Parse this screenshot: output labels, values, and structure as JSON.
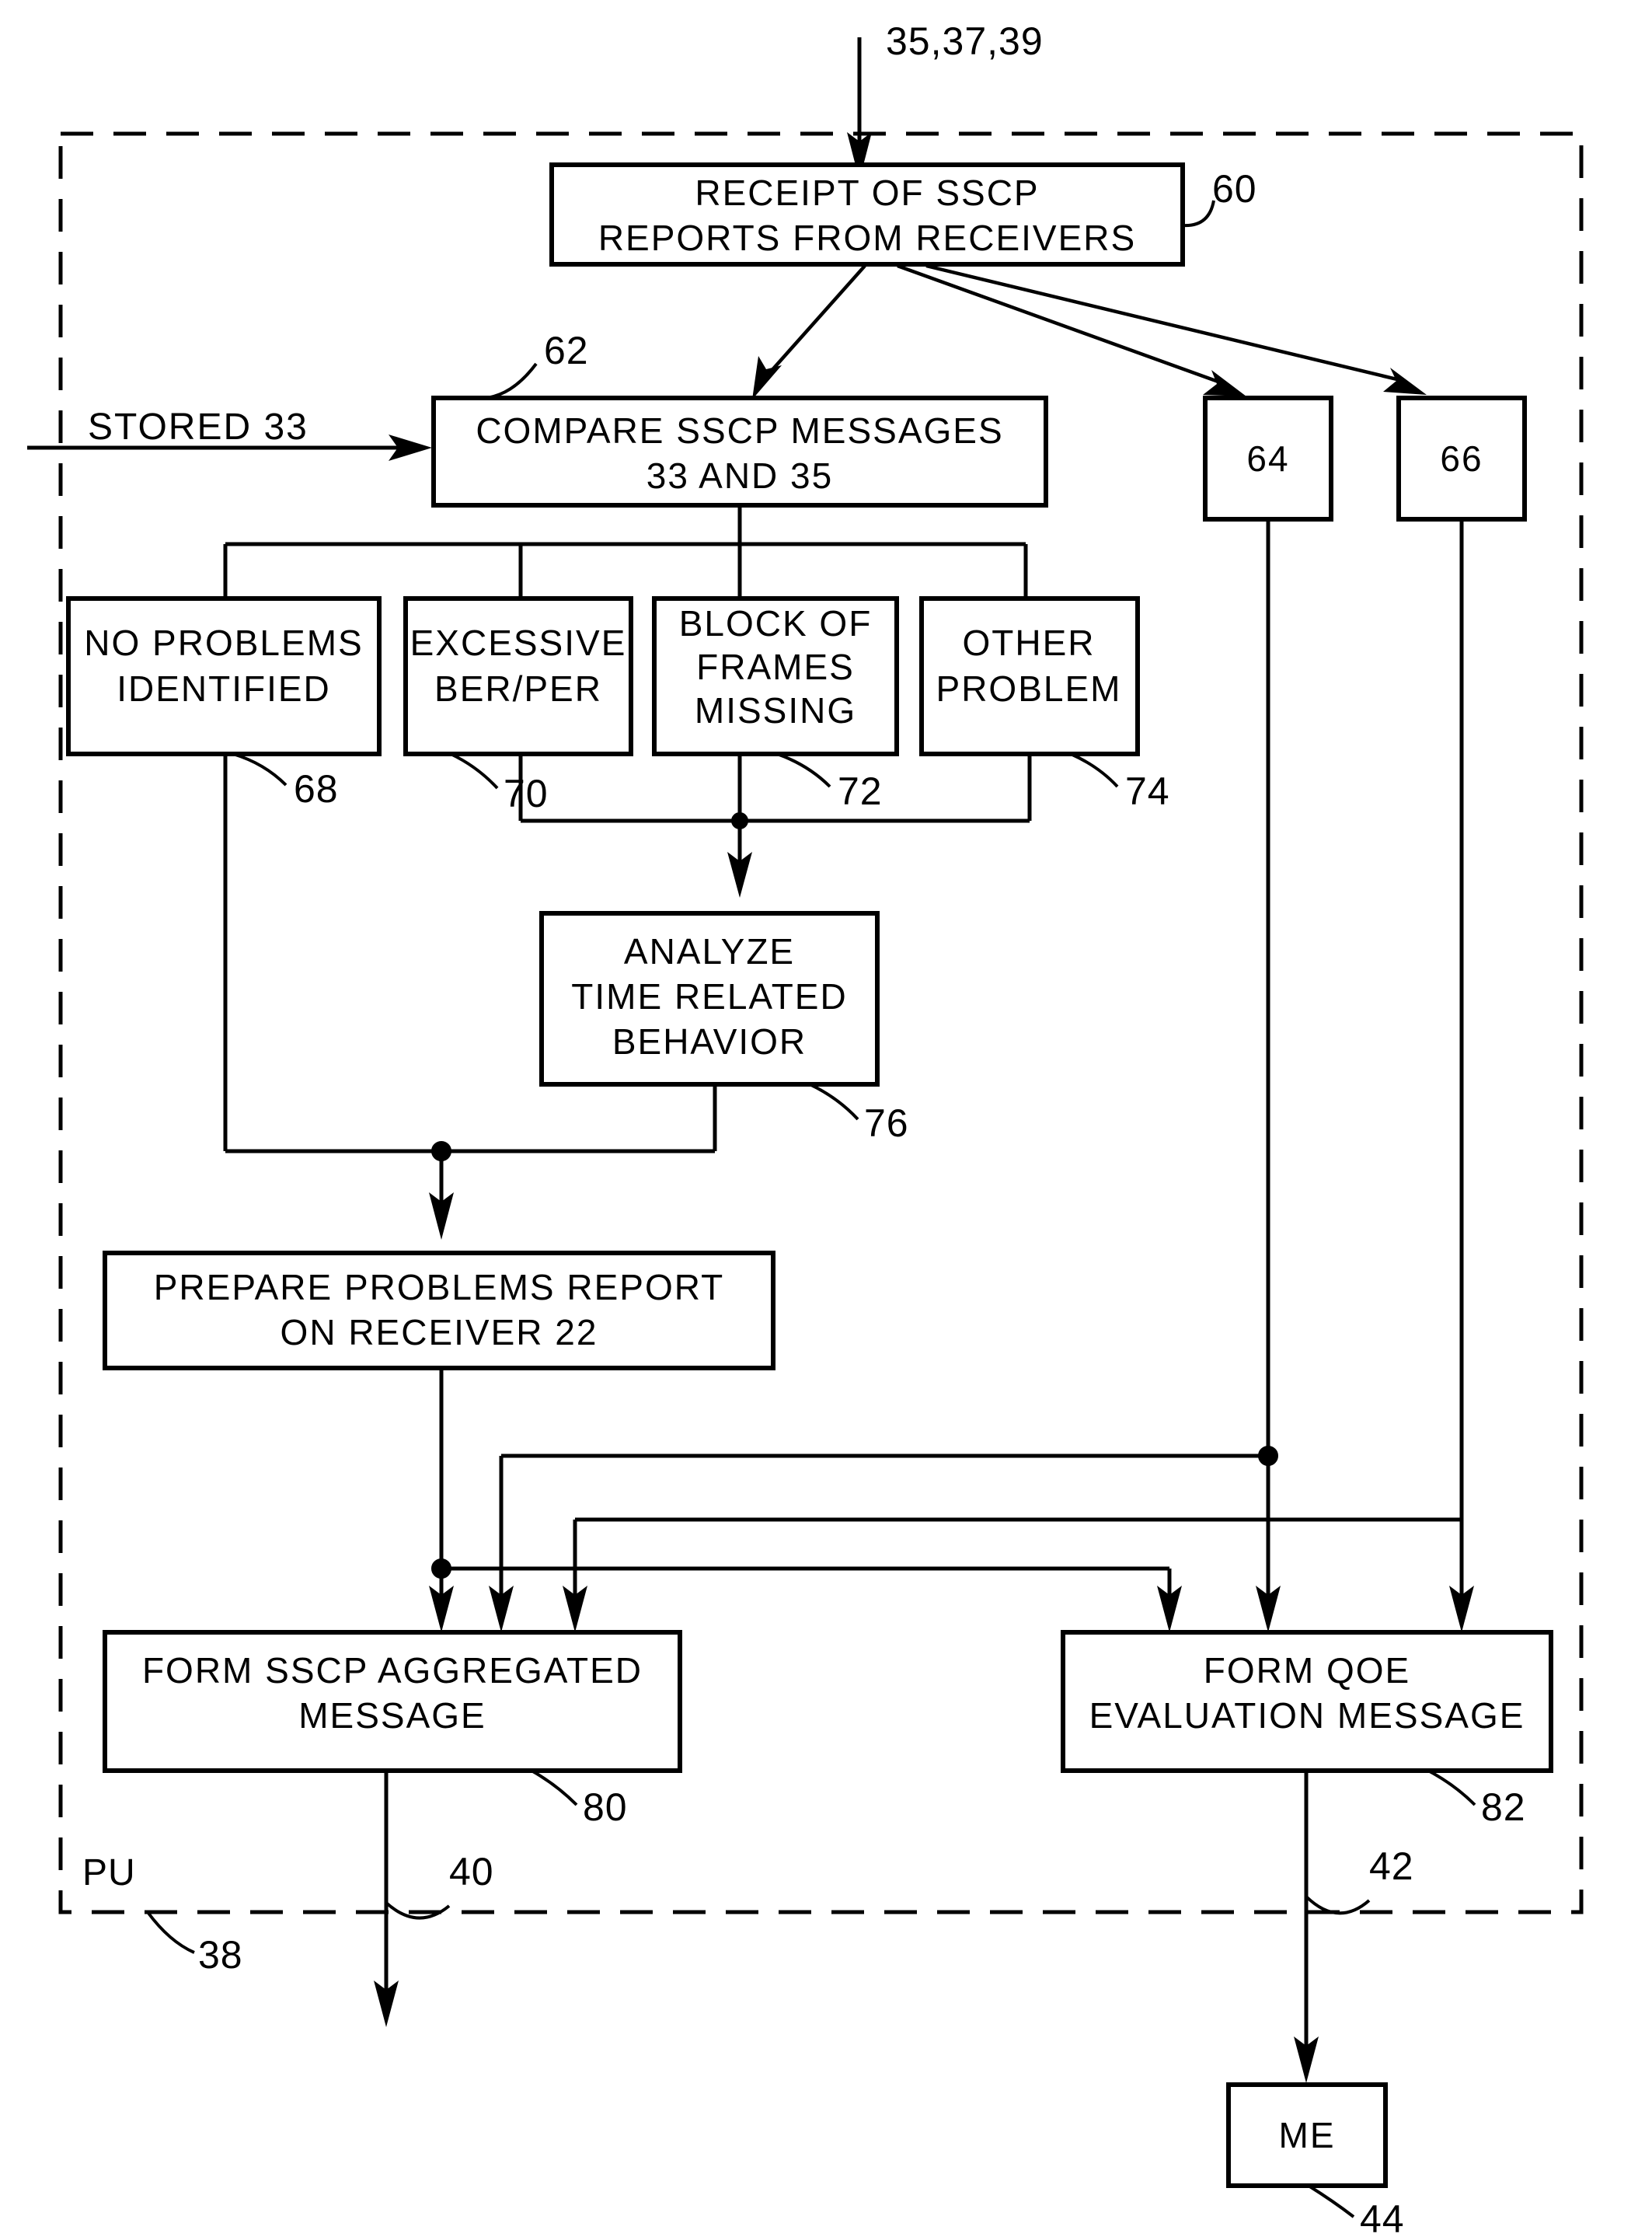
{
  "figure": {
    "title": "SSCP report processing flowchart",
    "boundary_label": "PU",
    "boundary_ref": "38",
    "line_color": "#000000",
    "background_color": "#ffffff"
  },
  "inputs": {
    "top_input_ref": "35,37,39",
    "left_input_label": "STORED  33"
  },
  "boxes": [
    {
      "id": "receipt",
      "ref": "60",
      "lines": [
        "RECEIPT  OF  SSCP",
        "REPORTS  FROM  RECEIVERS"
      ]
    },
    {
      "id": "compare",
      "ref": "62",
      "lines": [
        "COMPARE  SSCP  MESSAGES",
        "33  AND  35"
      ]
    },
    {
      "id": "node64",
      "ref": "",
      "lines": [
        "64"
      ]
    },
    {
      "id": "node66",
      "ref": "",
      "lines": [
        "66"
      ]
    },
    {
      "id": "no-problems",
      "ref": "68",
      "lines": [
        "NO  PROBLEMS",
        "IDENTIFIED"
      ]
    },
    {
      "id": "excessive-ber",
      "ref": "70",
      "lines": [
        "EXCESSIVE",
        "BER/PER"
      ]
    },
    {
      "id": "block-frames",
      "ref": "72",
      "lines": [
        "BLOCK  OF",
        "FRAMES",
        "MISSING"
      ]
    },
    {
      "id": "other-problem",
      "ref": "74",
      "lines": [
        "OTHER",
        "PROBLEM"
      ]
    },
    {
      "id": "analyze",
      "ref": "76",
      "lines": [
        "ANALYZE",
        "TIME  RELATED",
        "BEHAVIOR"
      ]
    },
    {
      "id": "prepare-report",
      "ref": "",
      "lines": [
        "PREPARE  PROBLEMS  REPORT",
        "ON  RECEIVER  22"
      ]
    },
    {
      "id": "form-sscp",
      "ref": "80",
      "lines": [
        "FORM  SSCP  AGGREGATED",
        "MESSAGE"
      ]
    },
    {
      "id": "form-qoe",
      "ref": "82",
      "lines": [
        "FORM  QOE",
        "EVALUATION  MESSAGE"
      ]
    },
    {
      "id": "me",
      "ref": "44",
      "lines": [
        "ME"
      ]
    }
  ],
  "box_text": {
    "receipt_l1": "RECEIPT  OF  SSCP",
    "receipt_l2": "REPORTS  FROM  RECEIVERS",
    "compare_l1": "COMPARE  SSCP  MESSAGES",
    "compare_l2": "33  AND  35",
    "node64": "64",
    "node66": "66",
    "noproblems_l1": "NO  PROBLEMS",
    "noproblems_l2": "IDENTIFIED",
    "excessive_l1": "EXCESSIVE",
    "excessive_l2": "BER/PER",
    "block_l1": "BLOCK  OF",
    "block_l2": "FRAMES",
    "block_l3": "MISSING",
    "other_l1": "OTHER",
    "other_l2": "PROBLEM",
    "analyze_l1": "ANALYZE",
    "analyze_l2": "TIME  RELATED",
    "analyze_l3": "BEHAVIOR",
    "prepare_l1": "PREPARE  PROBLEMS  REPORT",
    "prepare_l2": "ON  RECEIVER  22",
    "formsscp_l1": "FORM  SSCP  AGGREGATED",
    "formsscp_l2": "MESSAGE",
    "formqoe_l1": "FORM  QOE",
    "formqoe_l2": "EVALUATION  MESSAGE",
    "me": "ME"
  },
  "reference_numerals": {
    "top_input": "35,37,39",
    "receipt": "60",
    "compare": "62",
    "no_problems": "68",
    "excessive_ber": "70",
    "block_frames": "72",
    "other_problem": "74",
    "analyze": "76",
    "form_sscp": "80",
    "form_qoe": "82",
    "pu_boundary": "38",
    "sscp_output": "40",
    "qoe_output": "42",
    "me": "44"
  },
  "labels": {
    "stored_input": "STORED  33",
    "pu": "PU"
  }
}
